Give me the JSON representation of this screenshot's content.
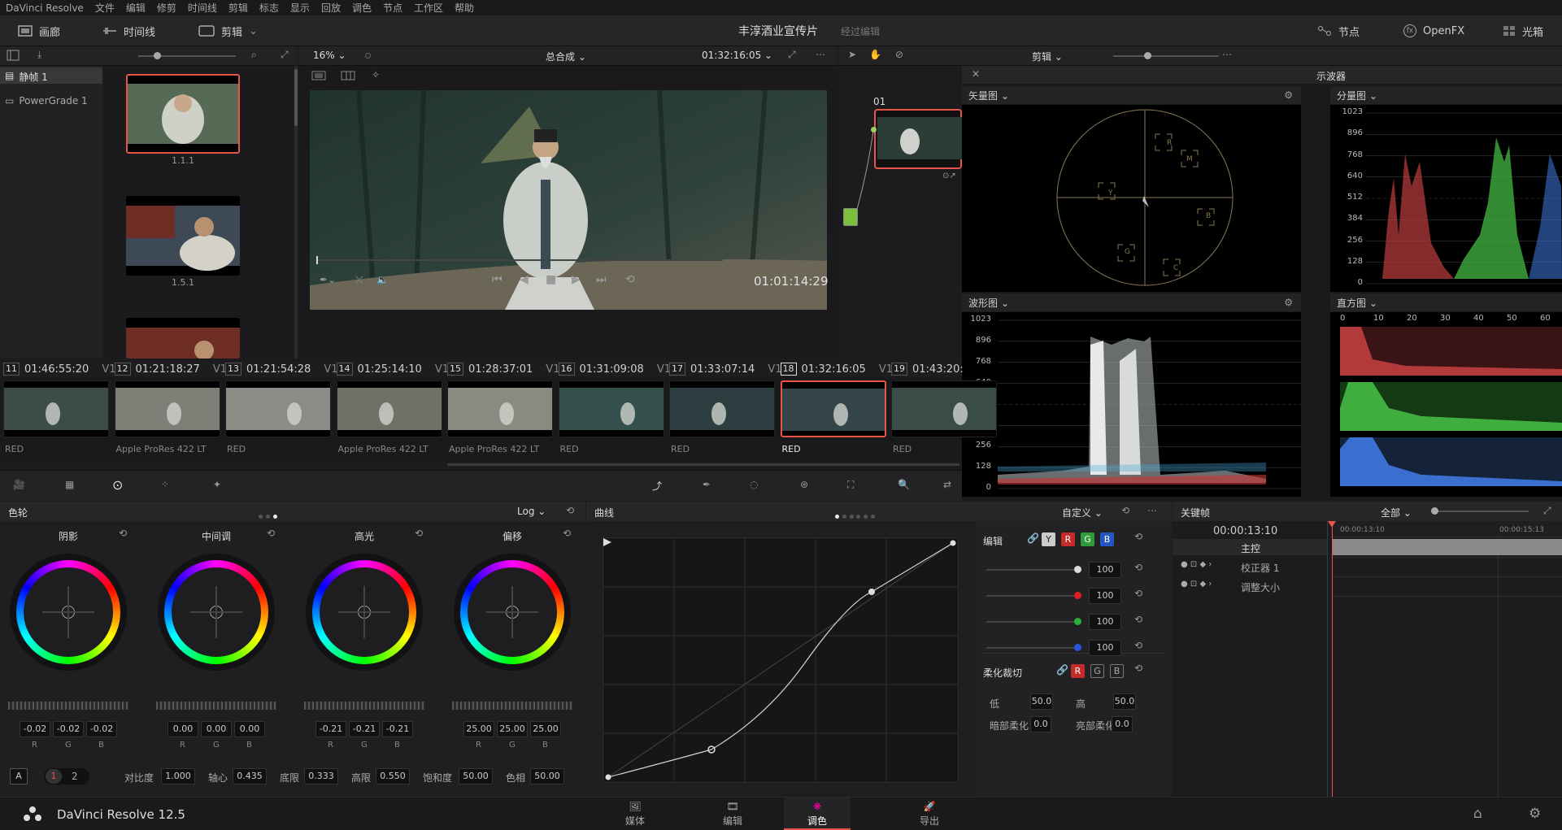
{
  "menubar": {
    "items": [
      "DaVinci Resolve",
      "文件",
      "编辑",
      "修剪",
      "时间线",
      "剪辑",
      "标志",
      "显示",
      "回放",
      "调色",
      "节点",
      "工作区",
      "帮助"
    ]
  },
  "toolbar": {
    "gallery": "画廊",
    "timeline": "时间线",
    "clip": "剪辑",
    "project_title": "丰淳酒业宣传片",
    "project_status": "经过编辑",
    "nodes": "节点",
    "openfx": "OpenFX",
    "lightbox": "光箱"
  },
  "gallery": {
    "items": [
      "静帧 1",
      "PowerGrade 1"
    ],
    "stills": [
      "1.1.1",
      "1.5.1"
    ]
  },
  "viewer": {
    "zoom": "16%",
    "title": "总合成",
    "timecode": "01:32:16:05",
    "playhead_time": "01:01:14:29",
    "playhead_progress": 0.01
  },
  "nodes": {
    "mode": "剪辑",
    "node_label": "01"
  },
  "scopes": {
    "title": "示波器",
    "vectorscope": "矢量图",
    "parade": "分量图",
    "waveform": "波形图",
    "histogram": "直方图",
    "vector_targets": [
      "R",
      "M",
      "B",
      "C",
      "G",
      "Y"
    ],
    "wave_ticks": [
      "1023",
      "896",
      "768",
      "640",
      "512",
      "384",
      "256",
      "128",
      "0"
    ],
    "parade_ticks": [
      "1023",
      "896",
      "768",
      "640",
      "512",
      "384",
      "256",
      "128",
      "0"
    ],
    "hist_ticks": [
      "0",
      "10",
      "20",
      "30",
      "40",
      "50",
      "60"
    ]
  },
  "clips": [
    {
      "num": "11",
      "tc": "01:46:55:20",
      "track": "V1",
      "codec": "RED"
    },
    {
      "num": "12",
      "tc": "01:21:18:27",
      "track": "V1",
      "codec": "Apple ProRes 422 LT"
    },
    {
      "num": "13",
      "tc": "01:21:54:28",
      "track": "V1",
      "codec": "RED"
    },
    {
      "num": "14",
      "tc": "01:25:14:10",
      "track": "V1",
      "codec": "Apple ProRes 422 LT"
    },
    {
      "num": "15",
      "tc": "01:28:37:01",
      "track": "V1",
      "codec": "Apple ProRes 422 LT"
    },
    {
      "num": "16",
      "tc": "01:31:09:08",
      "track": "V1",
      "codec": "RED"
    },
    {
      "num": "17",
      "tc": "01:33:07:14",
      "track": "V1",
      "codec": "RED"
    },
    {
      "num": "18",
      "tc": "01:32:16:05",
      "track": "V1",
      "codec": "RED"
    },
    {
      "num": "19",
      "tc": "01:43:20:",
      "track": "",
      "codec": "RED"
    }
  ],
  "colorwheels": {
    "title": "色轮",
    "mode": "Log",
    "wheels": [
      {
        "name": "阴影",
        "values": [
          "-0.02",
          "-0.02",
          "-0.02"
        ]
      },
      {
        "name": "中间调",
        "values": [
          "0.00",
          "0.00",
          "0.00"
        ]
      },
      {
        "name": "高光",
        "values": [
          "-0.21",
          "-0.21",
          "-0.21"
        ]
      },
      {
        "name": "偏移",
        "values": [
          "25.00",
          "25.00",
          "25.00"
        ]
      }
    ],
    "rgb": [
      "R",
      "G",
      "B"
    ],
    "bottom": {
      "a": "A",
      "p1": "1",
      "p2": "2",
      "contrast_label": "对比度",
      "contrast": "1.000",
      "pivot_label": "轴心",
      "pivot": "0.435",
      "low_label": "底限",
      "low": "0.333",
      "high_label": "高限",
      "high": "0.550",
      "sat_label": "饱和度",
      "sat": "50.00",
      "hue_label": "色相",
      "hue": "50.00"
    }
  },
  "curves": {
    "title": "曲线",
    "mode": "自定义",
    "edit_label": "编辑",
    "channels": [
      "Y",
      "R",
      "G",
      "B"
    ],
    "intensities": [
      "100",
      "100",
      "100",
      "100"
    ],
    "soft_clip": "柔化裁切",
    "low_label": "低",
    "low": "50.0",
    "high_label": "高",
    "high": "50.0",
    "ls_label": "暗部柔化",
    "ls": "0.0",
    "hs_label": "亮部柔化",
    "hs": "0.0"
  },
  "keyframes": {
    "title": "关键帧",
    "filter": "全部",
    "current": "00:00:13:10",
    "ruler_start": "00:00:13:10",
    "ruler_end": "00:00:15:13",
    "master": "主控",
    "tracks": [
      "校正器 1",
      "调整大小"
    ]
  },
  "bottomnav": {
    "brand": "DaVinci Resolve 12.5",
    "pages": [
      "媒体",
      "编辑",
      "调色",
      "导出"
    ]
  },
  "colors": {
    "accent": "#e8534a",
    "panel": "#1e1e20"
  }
}
